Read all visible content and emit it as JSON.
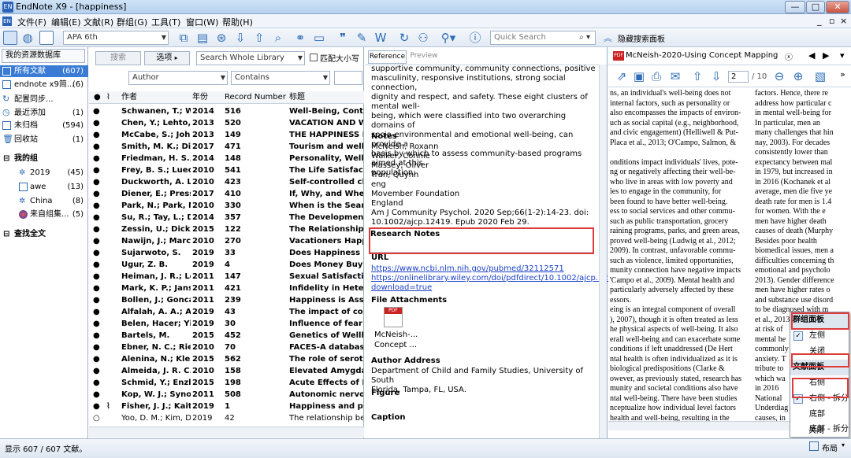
{
  "titlebar": {
    "title": "EndNote X9 - [happiness]",
    "logo": "EN",
    "min": "—",
    "max": "□",
    "close": "✕"
  },
  "menubar": {
    "items": [
      "文件(F)",
      "编辑(E)",
      "文献(R)",
      "群组(G)",
      "工具(T)",
      "窗口(W)",
      "帮助(H)"
    ],
    "inner_controls": [
      "_",
      "▫",
      "×"
    ]
  },
  "toolbar": {
    "style": "APA 6th",
    "quick_search_placeholder": "Quick Search",
    "hide_search": "隐藏搜索面板"
  },
  "left": {
    "header": "我的资源数据库",
    "items": [
      {
        "label": "所有文献",
        "count": "(607)"
      },
      {
        "label": "endnote x9简...",
        "count": "(6)"
      },
      {
        "label": "配置同步...",
        "count": ""
      },
      {
        "label": "最近添加",
        "count": "(1)"
      },
      {
        "label": "未归档",
        "count": "(594)"
      },
      {
        "label": "回收站",
        "count": "(1)"
      }
    ],
    "my_groups": "我的组",
    "groups": [
      {
        "label": "2019",
        "count": "(45)"
      },
      {
        "label": "awe",
        "count": "(13)"
      },
      {
        "label": "China",
        "count": "(8)"
      },
      {
        "label": "来自组集...",
        "count": "(5)"
      }
    ],
    "find_full_text": "查找全文"
  },
  "search": {
    "search_btn": "搜索",
    "options_btn": "选项",
    "scope": "Search Whole Library",
    "match_case": "匹配大小写",
    "field": "Author",
    "op": "Contains"
  },
  "table": {
    "headers": {
      "author": "作者",
      "year": "年份",
      "record": "Record Number",
      "title": "标题"
    },
    "rows": [
      {
        "author": "Schwanen, T.; W...",
        "year": "2014",
        "rec": "516",
        "title": "Well-Being, Conte"
      },
      {
        "author": "Chen, Y.; Lehto, X...",
        "year": "2013",
        "rec": "520",
        "title": "VACATION AND W"
      },
      {
        "author": "McCabe, S.; John...",
        "year": "2013",
        "rec": "149",
        "title": "THE HAPPINESS F"
      },
      {
        "author": "Smith, M. K.; Die...",
        "year": "2017",
        "rec": "471",
        "title": "Tourism and wellb"
      },
      {
        "author": "Friedman, H. S.; ...",
        "year": "2014",
        "rec": "148",
        "title": "Personality, Well-l"
      },
      {
        "author": "Frey, B. S.; Luechi...",
        "year": "2010",
        "rec": "541",
        "title": "The Life Satisfacti"
      },
      {
        "author": "Duckworth, A. L.;...",
        "year": "2010",
        "rec": "423",
        "title": "Self-controlled ch"
      },
      {
        "author": "Diener, E.; Press...",
        "year": "2017",
        "rec": "410",
        "title": "If, Why, and Wher"
      },
      {
        "author": "Park, N.; Park, M....",
        "year": "2010",
        "rec": "330",
        "title": "When is the Searc"
      },
      {
        "author": "Su, R.; Tay, L.; Die...",
        "year": "2014",
        "rec": "357",
        "title": "The Development"
      },
      {
        "author": "Zessin, U.; Dickha...",
        "year": "2015",
        "rec": "122",
        "title": "The Relationship E"
      },
      {
        "author": "Nawijn, J.; March...",
        "year": "2010",
        "rec": "270",
        "title": "Vacationers Happi"
      },
      {
        "author": "Sujarwoto, S.",
        "year": "2019",
        "rec": "33",
        "title": "Does Happiness Pa"
      },
      {
        "author": "Ugur, Z. B.",
        "year": "2019",
        "rec": "4",
        "title": "Does Money Buy H"
      },
      {
        "author": "Heiman, J. R.; Lo...",
        "year": "2011",
        "rec": "147",
        "title": "Sexual Satisfactio"
      },
      {
        "author": "Mark, K. P.; Janss...",
        "year": "2011",
        "rec": "421",
        "title": "Infidelity in Heter"
      },
      {
        "author": "Bollen, J.; Goncal...",
        "year": "2011",
        "rec": "239",
        "title": "Happiness is Assor"
      },
      {
        "author": "Alfalah, A. A.; Alg...",
        "year": "2019",
        "rec": "43",
        "title": "The impact of con"
      },
      {
        "author": "Belen, Hacer; Yil...",
        "year": "2019",
        "rec": "30",
        "title": "Influence of fear c"
      },
      {
        "author": "Bartels, M.",
        "year": "2015",
        "rec": "452",
        "title": "Genetics of Wellb"
      },
      {
        "author": "Ebner, N. C.; Ried...",
        "year": "2010",
        "rec": "70",
        "title": "FACES-A database"
      },
      {
        "author": "Alenina, N.; Klem...",
        "year": "2015",
        "rec": "562",
        "title": "The role of seroto"
      },
      {
        "author": "Almeida, J. R. C.; ...",
        "year": "2010",
        "rec": "158",
        "title": "Elevated Amygdal"
      },
      {
        "author": "Schmid, Y.; Enzle...",
        "year": "2015",
        "rec": "198",
        "title": "Acute Effects of Ly"
      },
      {
        "author": "Kop, W. J.; Syno...",
        "year": "2011",
        "rec": "508",
        "title": "Autonomic nervou"
      },
      {
        "author": "Fisher, J. J.; Kaitel...",
        "year": "2019",
        "rec": "1",
        "title": "Happiness and phy"
      },
      {
        "author": "Yoo, D. M.; Kim, D...",
        "year": "2019",
        "rec": "42",
        "title": "The relationship be"
      }
    ]
  },
  "reference": {
    "tab_reference": "Reference",
    "tab_preview": "Preview",
    "abstract_lines": [
      "supportive community, community connections, positive",
      "masculinity, responsive institutions, strong social connection,",
      "dignity and respect, and safety. These eight clusters of mental well-",
      "being, which were classified into two overarching domains of",
      "socio-environmental and emotional well-being, can provide a",
      "basis by which to assess community-based programs aimed at this",
      "population."
    ],
    "notes_label": "Notes",
    "notes_lines": [
      "McNeish, Roxann",
      "Walker, Connie",
      "Massey, Oliver",
      "Tran, Quynh",
      "eng",
      "Movember Foundation",
      "England",
      "Am J Community Psychol. 2020 Sep;66(1-2):14-23. doi:",
      "10.1002/ajcp.12419. Epub 2020 Feb 29."
    ],
    "research_notes_label": "Research Notes",
    "url_label": "URL",
    "url_lines": [
      "https://www.ncbi.nlm.nih.gov/pubmed/32112571",
      "https://onlinelibrary.wiley.com/doi/pdfdirect/10.1002/ajcp.12419?",
      "download=true"
    ],
    "attachments_label": "File Attachments",
    "attachment_name": "McNeish-...",
    "attachment_name2": "Concept ...",
    "pdf_icon_text": "PDF",
    "author_address_label": "Author Address",
    "author_address_lines": [
      "Department of Child and Family Studies, University of South",
      "Florida, Tampa, FL, USA."
    ],
    "figure_label": "Figure",
    "caption_label": "Caption"
  },
  "pdf": {
    "tab_title": "McNeish-2020-Using Concept Mapping to Opera",
    "page_current": "2",
    "page_total": "/ 10",
    "col1": [
      "ns, an individual's well-being does not",
      "internal factors, such as personality or",
      "also encompasses the impacts of environ-",
      "uch as social capital (e.g., neighborhood,",
      "and civic engagement) (Helliwell & Put-",
      "Placa et al., 2013; O'Campo, Salmon, &",
      "",
      "onditions impact individuals' lives, pote-",
      "ng or negatively affecting their well-be-",
      "who live in areas with low poverty and",
      "ies to engage in the community, for",
      "been found to have better well-being.",
      "ess to social services and other commu-",
      "such as public transportation, grocery",
      "raining programs, parks, and green areas,",
      "proved well-being (Ludwig et al., 2012;",
      "2009). In contrast, unfavorable commu-",
      "such as violence, limited opportunities,",
      "munity connection have negative impacts",
      "'Campo et al., 2009). Mental health and",
      "particularly adversely affected by these",
      "essors.",
      "eing is an integral component of overall",
      "), 2007), though it is often treated as less",
      "he physical aspects of well-being. It also",
      "erall well-being and can exacerbate some",
      "conditions if left unaddressed (De Hert",
      "ntal health is often individualized as it is",
      "biological predispositions (Clarke &",
      "owever, as previously stated, research has",
      "munity and societal conditions also have",
      "ntal well-being. There have been studies",
      "nceptualize how individual level factors",
      "health and well-being, resulting in the",
      "assessments of various individual mental"
    ],
    "col2": [
      "factors. Hence, there re",
      "address how particular c",
      "in mental well-being for",
      "In particular, men an",
      "many challenges that hin",
      "nay, 2003). For decades",
      "consistently lower than",
      "expectancy between mal",
      "in 1979, but increased in",
      "in 2016 (Kochanek et al",
      "average, men die five ye",
      "death rate for men is 1.4",
      "for women. With the e",
      "men have higher death",
      "causes of death (Murphy",
      "Besides poor health",
      "biomedical issues, men a",
      "difficulties concerning th",
      "emotional and psycholo",
      "2013). Gender difference",
      "men have higher rates o",
      "and substance use disord",
      "to be diagnosed with m",
      "et al., 2013). Sc",
      "at risk of",
      "mental he",
      "commonly",
      "anxiety. T",
      "tribute to",
      "which wa",
      "in 2016",
      "National",
      "Underdiag",
      "causes, in",
      "norms and"
    ]
  },
  "context_menu": {
    "group_panel": "群组面板",
    "left": "左侧",
    "close1": "关闭",
    "ref_panel": "文献面板",
    "right": "右侧",
    "right_split": "右侧 - 拆分",
    "bottom": "底部",
    "bottom_split": "底部 - 拆分",
    "close2": "关闭"
  },
  "status": {
    "text": "显示 607 / 607 文献。",
    "layout": "布局"
  }
}
